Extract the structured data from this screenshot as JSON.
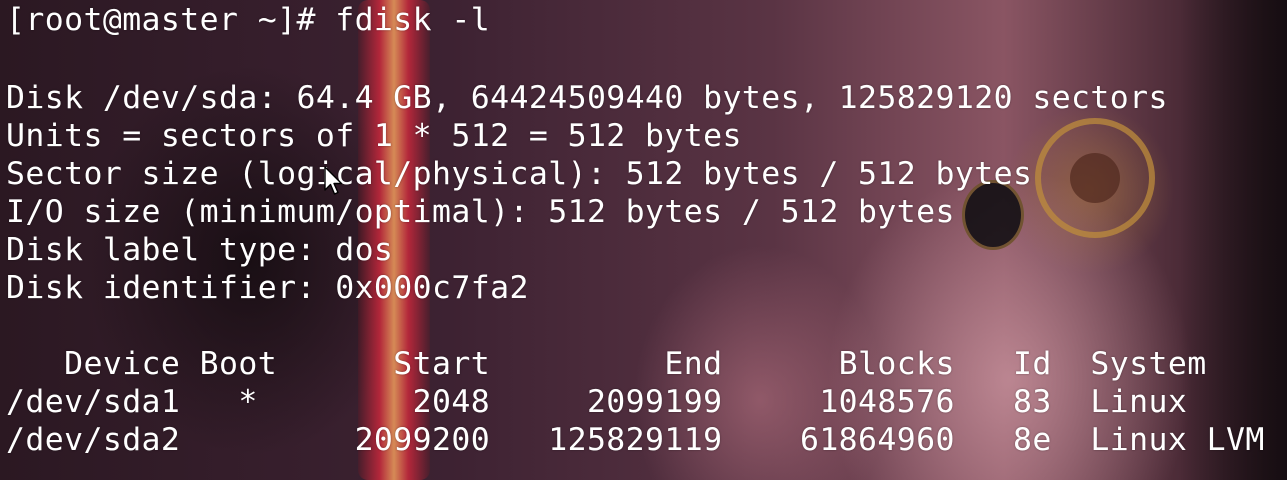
{
  "terminal": {
    "prompt_line": "[root@master ~]# fdisk -l",
    "disk_line": "Disk /dev/sda: 64.4 GB, 64424509440 bytes, 125829120 sectors",
    "units_line": "Units = sectors of 1 * 512 = 512 bytes",
    "sector_size_line": "Sector size (logical/physical): 512 bytes / 512 bytes",
    "io_size_line": "I/O size (minimum/optimal): 512 bytes / 512 bytes",
    "label_type_line": "Disk label type: dos",
    "identifier_line": "Disk identifier: 0x000c7fa2",
    "table_header": "   Device Boot      Start         End      Blocks   Id  System",
    "partitions": [
      "/dev/sda1   *        2048     2099199     1048576   83  Linux",
      "/dev/sda2         2099200   125829119    61864960   8e  Linux LVM"
    ]
  },
  "colors": {
    "text": "#ffffff",
    "background": "#3a2030"
  },
  "icons": {
    "pointer": "mouse-pointer-icon"
  }
}
